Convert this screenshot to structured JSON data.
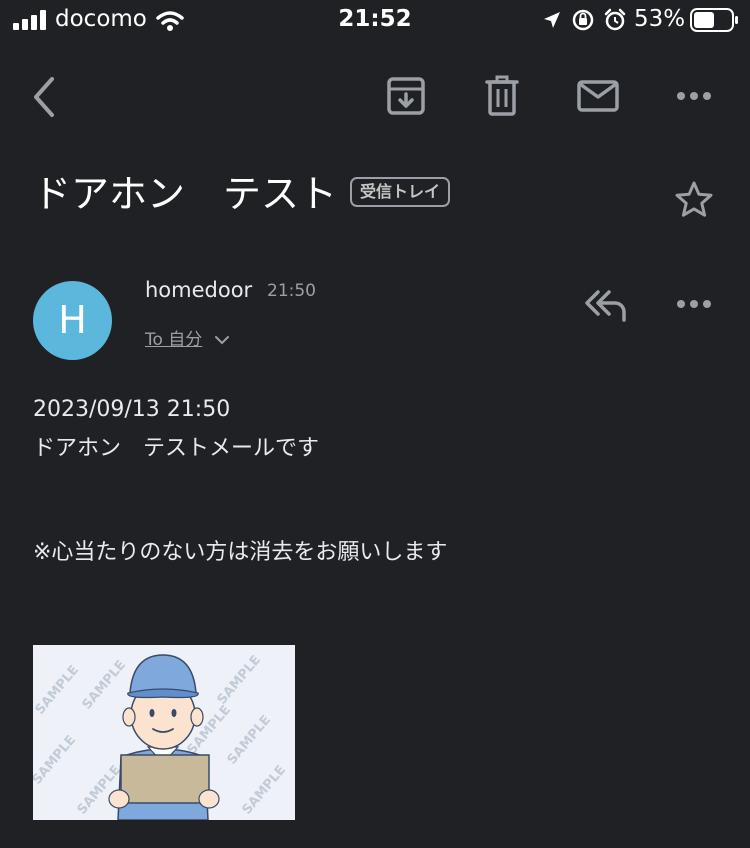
{
  "status_bar": {
    "carrier": "docomo",
    "time": "21:52",
    "battery": "53%"
  },
  "toolbar": {
    "back_icon": "chevron-left-icon",
    "archive_icon": "archive-icon",
    "delete_icon": "trash-icon",
    "mark_unread_icon": "mail-icon",
    "more_icon": "more-horizontal-icon"
  },
  "email": {
    "subject": "ドアホン　テスト",
    "label": "受信トレイ",
    "sender_initial": "H",
    "sender": "homedoor",
    "time": "21:50",
    "recipient": "To 自分",
    "body": [
      "2023/09/13 21:50",
      "ドアホン　テストメールです",
      "※心当たりのない方は消去をお願いします"
    ],
    "attachment_watermark": "SAMPLE"
  },
  "colors": {
    "background": "#202124",
    "avatar": "#5bb8dc",
    "icon": "#9aa0a6"
  }
}
